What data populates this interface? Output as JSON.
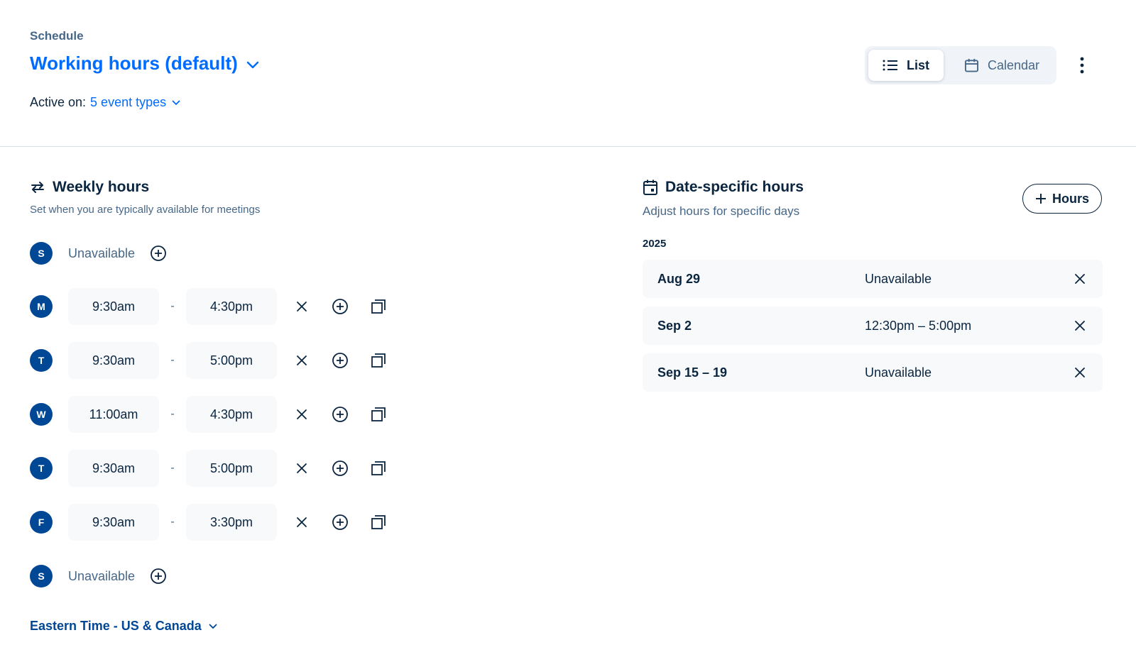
{
  "header": {
    "label": "Schedule",
    "title": "Working hours (default)",
    "active_on_label": "Active on:",
    "active_on_value": "5 event types"
  },
  "view_toggle": {
    "list_label": "List",
    "calendar_label": "Calendar",
    "selected": "List"
  },
  "weekly": {
    "title": "Weekly hours",
    "subtitle": "Set when you are typically available for meetings",
    "days": [
      {
        "letter": "S",
        "available": false,
        "unavailable_label": "Unavailable"
      },
      {
        "letter": "M",
        "available": true,
        "start": "9:30am",
        "end": "4:30pm"
      },
      {
        "letter": "T",
        "available": true,
        "start": "9:30am",
        "end": "5:00pm"
      },
      {
        "letter": "W",
        "available": true,
        "start": "11:00am",
        "end": "4:30pm"
      },
      {
        "letter": "T",
        "available": true,
        "start": "9:30am",
        "end": "5:00pm"
      },
      {
        "letter": "F",
        "available": true,
        "start": "9:30am",
        "end": "3:30pm"
      },
      {
        "letter": "S",
        "available": false,
        "unavailable_label": "Unavailable"
      }
    ],
    "separator": "-",
    "timezone": "Eastern Time - US & Canada"
  },
  "date_specific": {
    "title": "Date-specific hours",
    "subtitle": "Adjust hours for specific days",
    "add_button": "Hours",
    "year": "2025",
    "entries": [
      {
        "date": "Aug 29",
        "value": "Unavailable"
      },
      {
        "date": "Sep 2",
        "value": "12:30pm – 5:00pm"
      },
      {
        "date": "Sep 15 – 19",
        "value": "Unavailable"
      }
    ]
  },
  "colors": {
    "primary_blue": "#006bff",
    "day_badge": "#004796",
    "text_dark": "#0a2540",
    "text_muted": "#476788",
    "field_bg": "#f8f9fb"
  },
  "icons": {
    "title_dropdown": "chevron-down-icon",
    "list_view": "list-icon",
    "calendar_view": "calendar-icon",
    "more": "kebab-icon",
    "weekly": "repeat-icon",
    "date_specific": "calendar-date-icon",
    "remove": "close-icon",
    "add": "add-circle-icon",
    "copy": "copy-icon"
  }
}
